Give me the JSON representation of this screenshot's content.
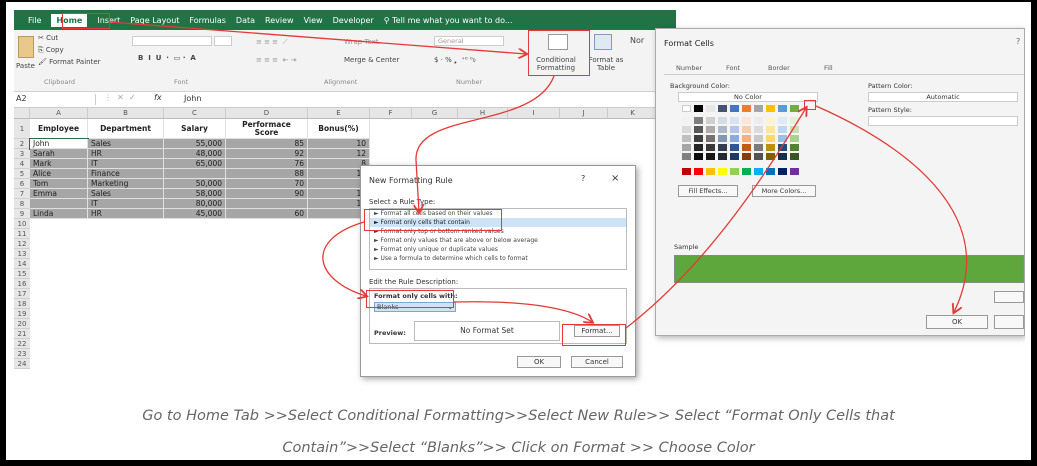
{
  "ribbon": {
    "tabs": [
      "File",
      "Home",
      "Insert",
      "Page Layout",
      "Formulas",
      "Data",
      "Review",
      "View",
      "Developer"
    ],
    "tell_me": "Tell me what you want to do...",
    "clipboard": {
      "cut": "Cut",
      "copy": "Copy",
      "paste": "Paste",
      "format_painter": "Format Painter",
      "group": "Clipboard"
    },
    "font_group": "Font",
    "alignment": {
      "wrap": "Wrap Text",
      "merge": "Merge & Center",
      "group": "Alignment"
    },
    "number": {
      "format": "General",
      "group": "Number"
    },
    "cond_format": "Conditional Formatting",
    "format_table": "Format as Table",
    "styles_cut": "Nor"
  },
  "formula_bar": {
    "name_box": "A2",
    "fx": "fx",
    "value": "John"
  },
  "sheet": {
    "columns": [
      "A",
      "B",
      "C",
      "D",
      "E",
      "F",
      "G",
      "H",
      "I",
      "J",
      "K"
    ],
    "headers": [
      "Employee",
      "Department",
      "Salary",
      "Performace Score",
      "Bonus(%)"
    ],
    "rows": [
      [
        "John",
        "Sales",
        "55,000",
        "85",
        "10"
      ],
      [
        "Sarah",
        "HR",
        "48,000",
        "92",
        "12"
      ],
      [
        "Mark",
        "IT",
        "65,000",
        "76",
        "8"
      ],
      [
        "Alice",
        "Finance",
        "",
        "88",
        "10"
      ],
      [
        "Tom",
        "Marketing",
        "50,000",
        "70",
        "5"
      ],
      [
        "Emma",
        "Sales",
        "58,000",
        "90",
        "15"
      ],
      [
        "",
        "IT",
        "80,000",
        "",
        "18"
      ],
      [
        "Linda",
        "HR",
        "45,000",
        "60",
        "3"
      ]
    ],
    "row_numbers": [
      "1",
      "2",
      "3",
      "4",
      "5",
      "6",
      "7",
      "8",
      "9",
      "10",
      "11",
      "12",
      "13",
      "14",
      "15",
      "16",
      "17",
      "18",
      "19",
      "20",
      "21",
      "22",
      "23",
      "24"
    ]
  },
  "new_rule": {
    "title": "New Formatting Rule",
    "help": "?",
    "close": "×",
    "select_type": "Select a Rule Type:",
    "rule_types": [
      "► Format all cells based on their values",
      "► Format only cells that contain",
      "► Format only top or bottom ranked values",
      "► Format only values that are above or below average",
      "► Format only unique or duplicate values",
      "► Use a formula to determine which cells to format"
    ],
    "edit_desc": "Edit the Rule Description:",
    "format_only": "Format only cells with:",
    "blanks": "Blanks",
    "preview_label": "Preview:",
    "preview_text": "No Format Set",
    "format_btn": "Format...",
    "ok": "OK",
    "cancel": "Cancel"
  },
  "format_cells": {
    "title": "Format Cells",
    "tabs": [
      "Number",
      "Font",
      "Border",
      "Fill"
    ],
    "bg_color": "Background Color:",
    "no_color": "No Color",
    "pattern_color": "Pattern Color:",
    "automatic": "Automatic",
    "pattern_style": "Pattern Style:",
    "fill_effects": "Fill Effects...",
    "more_colors": "More Colors...",
    "sample": "Sample",
    "ok": "OK",
    "sample_color": "#5da73c"
  },
  "caption": {
    "line1": "Go to Home Tab >>Select Conditional Formatting>>Select New Rule>> Select “Format Only Cells that",
    "line2": "Contain”>>Select “Blanks”>> Click on Format >> Choose Color"
  },
  "colors": {
    "excel_green": "#217346",
    "highlight_red": "#e53935",
    "selection_grey": "#a6a6a6"
  }
}
